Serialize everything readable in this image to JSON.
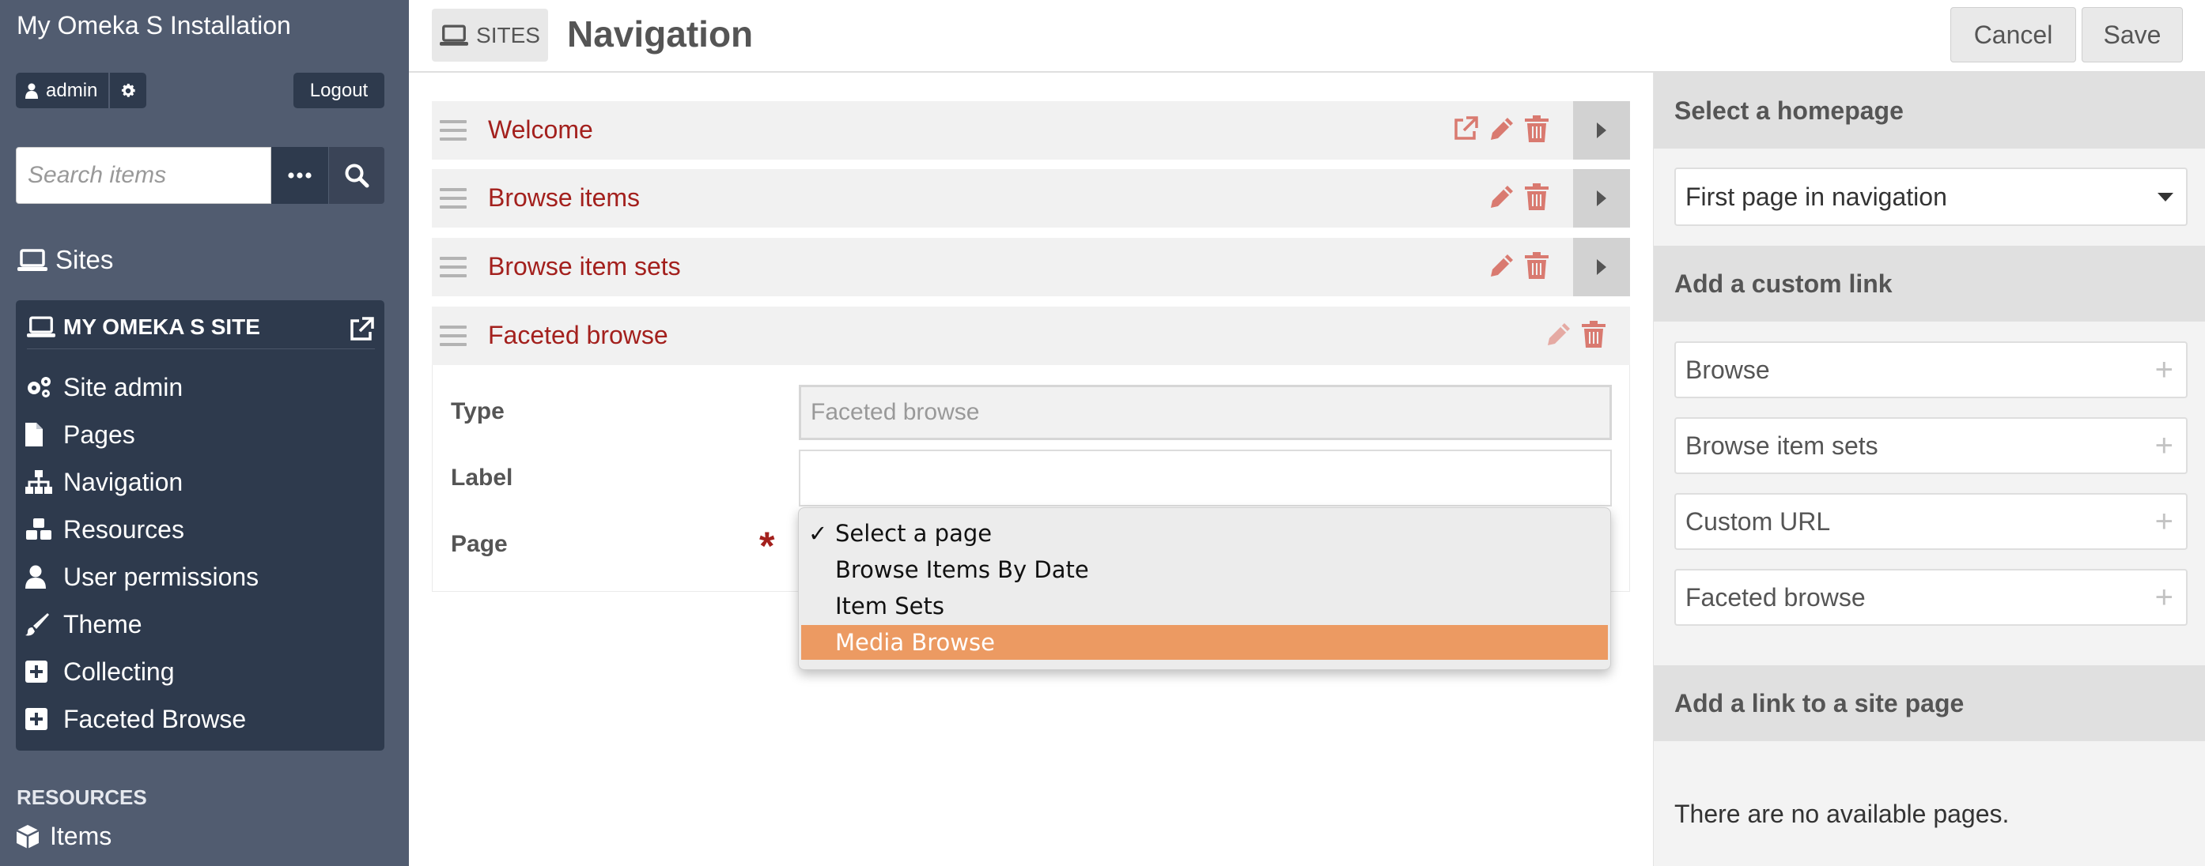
{
  "sidebar": {
    "install_title": "My Omeka S Installation",
    "user": "admin",
    "logout": "Logout",
    "search_placeholder": "Search items",
    "sites_label": "Sites",
    "site_name": "MY OMEKA S SITE",
    "menu": [
      {
        "label": "Site admin",
        "icon": "gears-icon"
      },
      {
        "label": "Pages",
        "icon": "file-icon"
      },
      {
        "label": "Navigation",
        "icon": "sitemap-icon"
      },
      {
        "label": "Resources",
        "icon": "cubes-icon"
      },
      {
        "label": "User permissions",
        "icon": "user-icon"
      },
      {
        "label": "Theme",
        "icon": "brush-icon"
      },
      {
        "label": "Collecting",
        "icon": "plus-square-icon"
      },
      {
        "label": "Faceted Browse",
        "icon": "plus-square-icon"
      }
    ],
    "resources_heading": "RESOURCES",
    "items_label": "Items"
  },
  "header": {
    "crumb": "SITES",
    "title": "Navigation",
    "cancel": "Cancel",
    "save": "Save"
  },
  "navigation": {
    "rows": [
      {
        "label": "Welcome"
      },
      {
        "label": "Browse items"
      },
      {
        "label": "Browse item sets"
      },
      {
        "label": "Faceted browse"
      }
    ],
    "form": {
      "type_label": "Type",
      "type_value": "Faceted browse",
      "label_label": "Label",
      "label_value": "",
      "page_label": "Page",
      "required_mark": "*"
    },
    "dropdown": {
      "check": "✓",
      "options": [
        "Select a page",
        "Browse Items By Date",
        "Item Sets",
        "Media Browse"
      ],
      "selected": "Select a page",
      "highlighted": "Media Browse"
    }
  },
  "right_panel": {
    "homepage_heading": "Select a homepage",
    "homepage_value": "First page in navigation",
    "custom_link_heading": "Add a custom link",
    "custom_links": [
      "Browse",
      "Browse item sets",
      "Custom URL",
      "Faceted browse"
    ],
    "plus": "+",
    "site_page_heading": "Add a link to a site page",
    "no_pages": "There are no available pages."
  },
  "colors": {
    "sidebar_bg": "#515c70",
    "sidebar_dark": "#2e3a4d",
    "link_red": "#a3201d",
    "icon_red": "#d97a70",
    "highlight": "#ec9a62"
  }
}
